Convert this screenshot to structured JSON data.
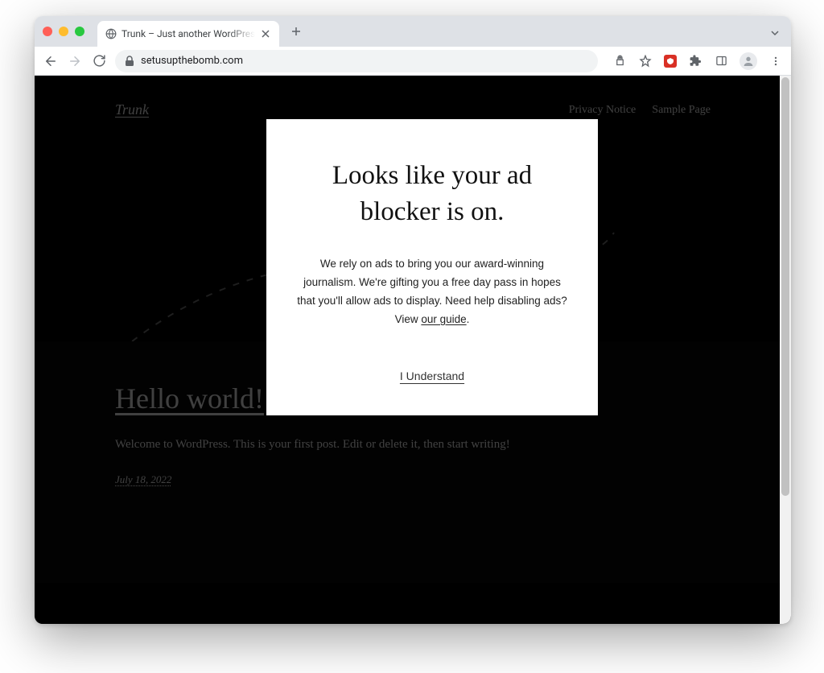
{
  "browser": {
    "tab_title": "Trunk – Just another WordPres",
    "url": "setusupthebomb.com"
  },
  "site": {
    "title": "Trunk",
    "nav": {
      "item1": "Privacy Notice",
      "item2": "Sample Page"
    }
  },
  "post": {
    "title": "Hello world!",
    "excerpt": "Welcome to WordPress. This is your first post. Edit or delete it, then start writing!",
    "date": "July 18, 2022"
  },
  "modal": {
    "title": "Looks like your ad blocker is on.",
    "body_prefix": "We rely on ads to bring you our award-winning journalism. We're gifting you a free day pass in hopes that you'll allow ads to display. Need help disabling ads? View ",
    "body_link": "our guide",
    "body_suffix": ".",
    "button": "I Understand"
  }
}
